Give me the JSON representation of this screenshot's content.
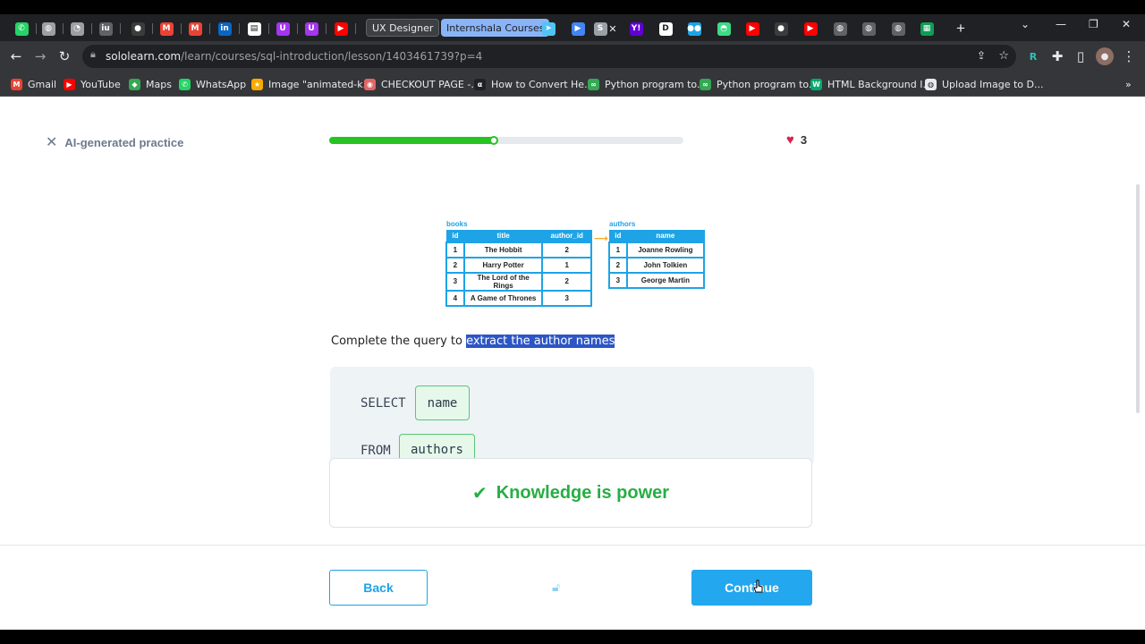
{
  "browser": {
    "tabs_named": [
      {
        "label": "UX Designer"
      },
      {
        "label": "Internshala Courses"
      }
    ],
    "favicons": [
      {
        "icon": "whatsapp-icon",
        "color": "#25d366",
        "glyph": "✆"
      },
      {
        "icon": "globe-icon",
        "color": "#9aa0a6",
        "glyph": "◍"
      },
      {
        "icon": "pinwheel-icon",
        "color": "#9aa0a6",
        "glyph": "◔"
      },
      {
        "icon": "iu-icon",
        "color": "#5f6368",
        "glyph": "iu"
      },
      {
        "icon": "github-icon",
        "color": "#3c3c3c",
        "glyph": "●"
      },
      {
        "icon": "gmail-icon",
        "color": "#ea4335",
        "glyph": "M"
      },
      {
        "icon": "gmail-icon",
        "color": "#ea4335",
        "glyph": "M"
      },
      {
        "icon": "linkedin-icon",
        "color": "#0a66c2",
        "glyph": "in"
      },
      {
        "icon": "page-icon",
        "color": "#ffffff",
        "glyph": "▤"
      },
      {
        "icon": "udemy-icon",
        "color": "#a435f0",
        "glyph": "U"
      },
      {
        "icon": "udemy-icon",
        "color": "#a435f0",
        "glyph": "U"
      },
      {
        "icon": "youtube-icon",
        "color": "#ff0000",
        "glyph": "▶"
      }
    ],
    "favicons_right": [
      {
        "icon": "bird-icon",
        "color": "#4fc3f7",
        "glyph": "➤"
      },
      {
        "icon": "play-icon",
        "color": "#4285f4",
        "glyph": "▶"
      },
      {
        "icon": "sololearn-icon",
        "color": "#9aa0a6",
        "glyph": "S"
      },
      {
        "icon": "yahoo-icon",
        "color": "#6001d2",
        "glyph": "Y!"
      },
      {
        "icon": "d-icon",
        "color": "#ffffff",
        "glyph": "D"
      },
      {
        "icon": "dots-icon",
        "color": "#1ea3e6",
        "glyph": "●●"
      },
      {
        "icon": "android-icon",
        "color": "#3ddc84",
        "glyph": "◓"
      },
      {
        "icon": "youtube-icon",
        "color": "#ff0000",
        "glyph": "▶"
      },
      {
        "icon": "github-icon",
        "color": "#3c3c3c",
        "glyph": "●"
      },
      {
        "icon": "youtube-icon",
        "color": "#ff0000",
        "glyph": "▶"
      },
      {
        "icon": "globe-icon",
        "color": "#5f6368",
        "glyph": "◍"
      },
      {
        "icon": "globe-icon",
        "color": "#5f6368",
        "glyph": "◍"
      },
      {
        "icon": "globe-icon",
        "color": "#5f6368",
        "glyph": "◍"
      },
      {
        "icon": "sheets-icon",
        "color": "#0f9d58",
        "glyph": "▦"
      }
    ],
    "url_host": "sololearn.com",
    "url_path": "/learn/courses/sql-introduction/lesson/1403461739?p=4",
    "bookmarks": [
      {
        "label": "Gmail",
        "icon": "gmail-icon",
        "color": "#ea4335",
        "glyph": "M"
      },
      {
        "label": "YouTube",
        "icon": "youtube-icon",
        "color": "#ff0000",
        "glyph": "▶"
      },
      {
        "label": "Maps",
        "icon": "maps-icon",
        "color": "#34a853",
        "glyph": "◆"
      },
      {
        "label": "WhatsApp",
        "icon": "whatsapp-icon",
        "color": "#25d366",
        "glyph": "✆"
      },
      {
        "label": "Image \"animated-k...",
        "icon": "star-icon",
        "color": "#f9ab00",
        "glyph": "★"
      },
      {
        "label": "CHECKOUT PAGE -...",
        "icon": "lips-icon",
        "color": "#e06666",
        "glyph": "◉"
      },
      {
        "label": "How to Convert He...",
        "icon": "alpha-icon",
        "color": "#202124",
        "glyph": "α"
      },
      {
        "label": "Python program to...",
        "icon": "link-icon",
        "color": "#34a853",
        "glyph": "∞"
      },
      {
        "label": "Python program to...",
        "icon": "link-icon",
        "color": "#34a853",
        "glyph": "∞"
      },
      {
        "label": "HTML Background I...",
        "icon": "w3-icon",
        "color": "#04aa6d",
        "glyph": "W"
      },
      {
        "label": "Upload Image to D...",
        "icon": "globe-icon",
        "color": "#e8eaed",
        "glyph": "◍"
      }
    ]
  },
  "lesson": {
    "practice_label": "AI-generated practice",
    "progress": 0.47,
    "hearts": "3",
    "books_caption": "books",
    "authors_caption": "authors",
    "books_headers": [
      "id",
      "title",
      "author_id"
    ],
    "books_rows": [
      [
        "1",
        "The Hobbit",
        "2"
      ],
      [
        "2",
        "Harry Potter",
        "1"
      ],
      [
        "3",
        "The Lord of the Rings",
        "2"
      ],
      [
        "4",
        "A Game of Thrones",
        "3"
      ]
    ],
    "authors_headers": [
      "id",
      "name"
    ],
    "authors_rows": [
      [
        "1",
        "Joanne Rowling"
      ],
      [
        "2",
        "John Tolkien"
      ],
      [
        "3",
        "George Martin"
      ]
    ],
    "prompt_plain": "Complete the query to ",
    "prompt_highlight": "extract the author names",
    "code": {
      "kw_select": "SELECT",
      "slot_1": "name",
      "kw_from": "FROM",
      "slot_2": "authors"
    },
    "feedback": "Knowledge is power",
    "back_label": "Back",
    "continue_label": "Continue"
  }
}
